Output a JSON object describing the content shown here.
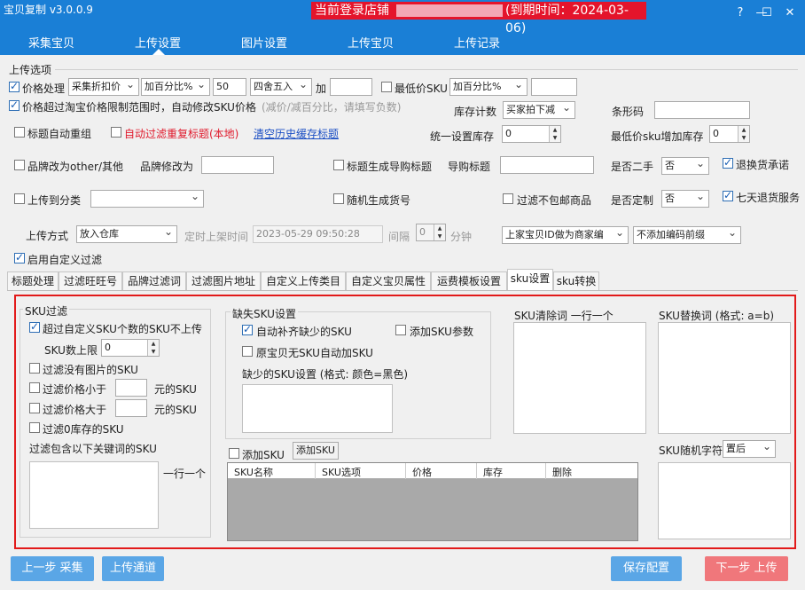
{
  "app_title": "宝贝复制 v3.0.0.9",
  "shop_banner": {
    "label": "当前登录店铺",
    "expiry": "(到期时间：2024-03-06)"
  },
  "window_controls": {
    "help": "?",
    "minimize": "—",
    "maximize": "☐",
    "close": "✕"
  },
  "nav_tabs": [
    "采集宝贝",
    "上传设置",
    "图片设置",
    "上传宝贝",
    "上传记录"
  ],
  "section_title": "上传选项",
  "row1": {
    "price_proc_label": "价格处理",
    "price_mode": "采集折扣价",
    "price_op": "加百分比%",
    "price_value": "50",
    "rounding": "四舍五入",
    "add_label": "加",
    "add_value": "",
    "min_sku_label": "最低价SKU",
    "min_sku_op": "加百分比%",
    "min_sku_value": ""
  },
  "row2": {
    "over_limit_label": "价格超过淘宝价格限制范围时，自动修改SKU价格",
    "hint": "(减价/减百分比，请填写负数)",
    "stock_count_label": "库存计数",
    "stock_count_value": "买家拍下减",
    "barcode_label": "条形码",
    "barcode_value": ""
  },
  "row3": {
    "auto_regroup_label": "标题自动重组",
    "auto_filter_label": "自动过滤重复标题(本地)",
    "clear_cache_link": "清空历史缓存标题",
    "unify_stock_label": "统一设置库存",
    "unify_stock_value": "0",
    "min_sku_stock_label": "最低价sku增加库存",
    "min_sku_stock_value": "0"
  },
  "row4": {
    "brand_other_label": "品牌改为other/其他",
    "brand_change_label": "品牌修改为",
    "brand_value": "",
    "guide_title_cb_label": "标题生成导购标题",
    "guide_title_label": "导购标题",
    "guide_title_value": "",
    "second_hand_label": "是否二手",
    "second_hand_value": "否",
    "return_promise_label": "退换货承诺"
  },
  "row5": {
    "upload_category_label": "上传到分类",
    "upload_category_value": "",
    "random_sku_no_label": "随机生成货号",
    "filter_no_free_ship_label": "过滤不包邮商品",
    "custom_label": "是否定制",
    "custom_value": "否",
    "seven_day_label": "七天退货服务"
  },
  "row6": {
    "upload_method_label": "上传方式",
    "upload_method_value": "放入仓库",
    "timed_label": "定时上架时间",
    "timed_value": "2023-05-29 09:50:28",
    "interval_label": "间隔",
    "interval_value": "0",
    "minute_label": "分钟",
    "merchant_code_value": "上家宝贝ID做为商家编",
    "prefix_value": "不添加编码前缀"
  },
  "custom_filter_label": "启用自定义过滤",
  "sub_tabs": [
    "标题处理",
    "过滤旺旺号",
    "品牌过滤词",
    "过滤图片地址",
    "自定义上传类目",
    "自定义宝贝属性",
    "运费模板设置",
    "sku设置",
    "sku转换"
  ],
  "sku_filter": {
    "title": "SKU过滤",
    "over_count_label": "超过自定义SKU个数的SKU不上传",
    "limit_label": "SKU数上限",
    "limit_value": "0",
    "no_image_label": "过滤没有图片的SKU",
    "price_less_label": "过滤价格小于",
    "price_less_value": "",
    "price_more_label": "过滤价格大于",
    "price_more_value": "",
    "yuan_sku": "元的SKU",
    "zero_stock_label": "过滤0库存的SKU",
    "keyword_label": "过滤包含以下关键词的SKU",
    "one_per_line": "一行一个"
  },
  "missing_sku": {
    "title": "缺失SKU设置",
    "auto_fill_label": "自动补齐缺少的SKU",
    "add_param_label": "添加SKU参数",
    "auto_add_label": "原宝贝无SKU自动加SKU",
    "format_label": "缺少的SKU设置 (格式: 颜色=黑色)"
  },
  "sku_clean_label": "SKU清除词  一行一个",
  "sku_replace_label": "SKU替换词 (格式: a=b)",
  "add_sku": {
    "cb_label": "添加SKU",
    "button_label": "添加SKU",
    "columns": [
      "SKU名称",
      "SKU选项",
      "价格",
      "库存",
      "删除"
    ]
  },
  "sku_random": {
    "label": "SKU随机字符",
    "value": "置后"
  },
  "bottom_buttons": {
    "prev": "上一步 采集",
    "channel": "上传通道",
    "save": "保存配置",
    "next": "下一步 上传"
  },
  "colors": {
    "title_bar": "#1a7fd6",
    "banner": "#e4142b",
    "highlight_frame": "#e21a1a",
    "button_blue": "#5aa6e6",
    "button_red": "#f0777b"
  }
}
